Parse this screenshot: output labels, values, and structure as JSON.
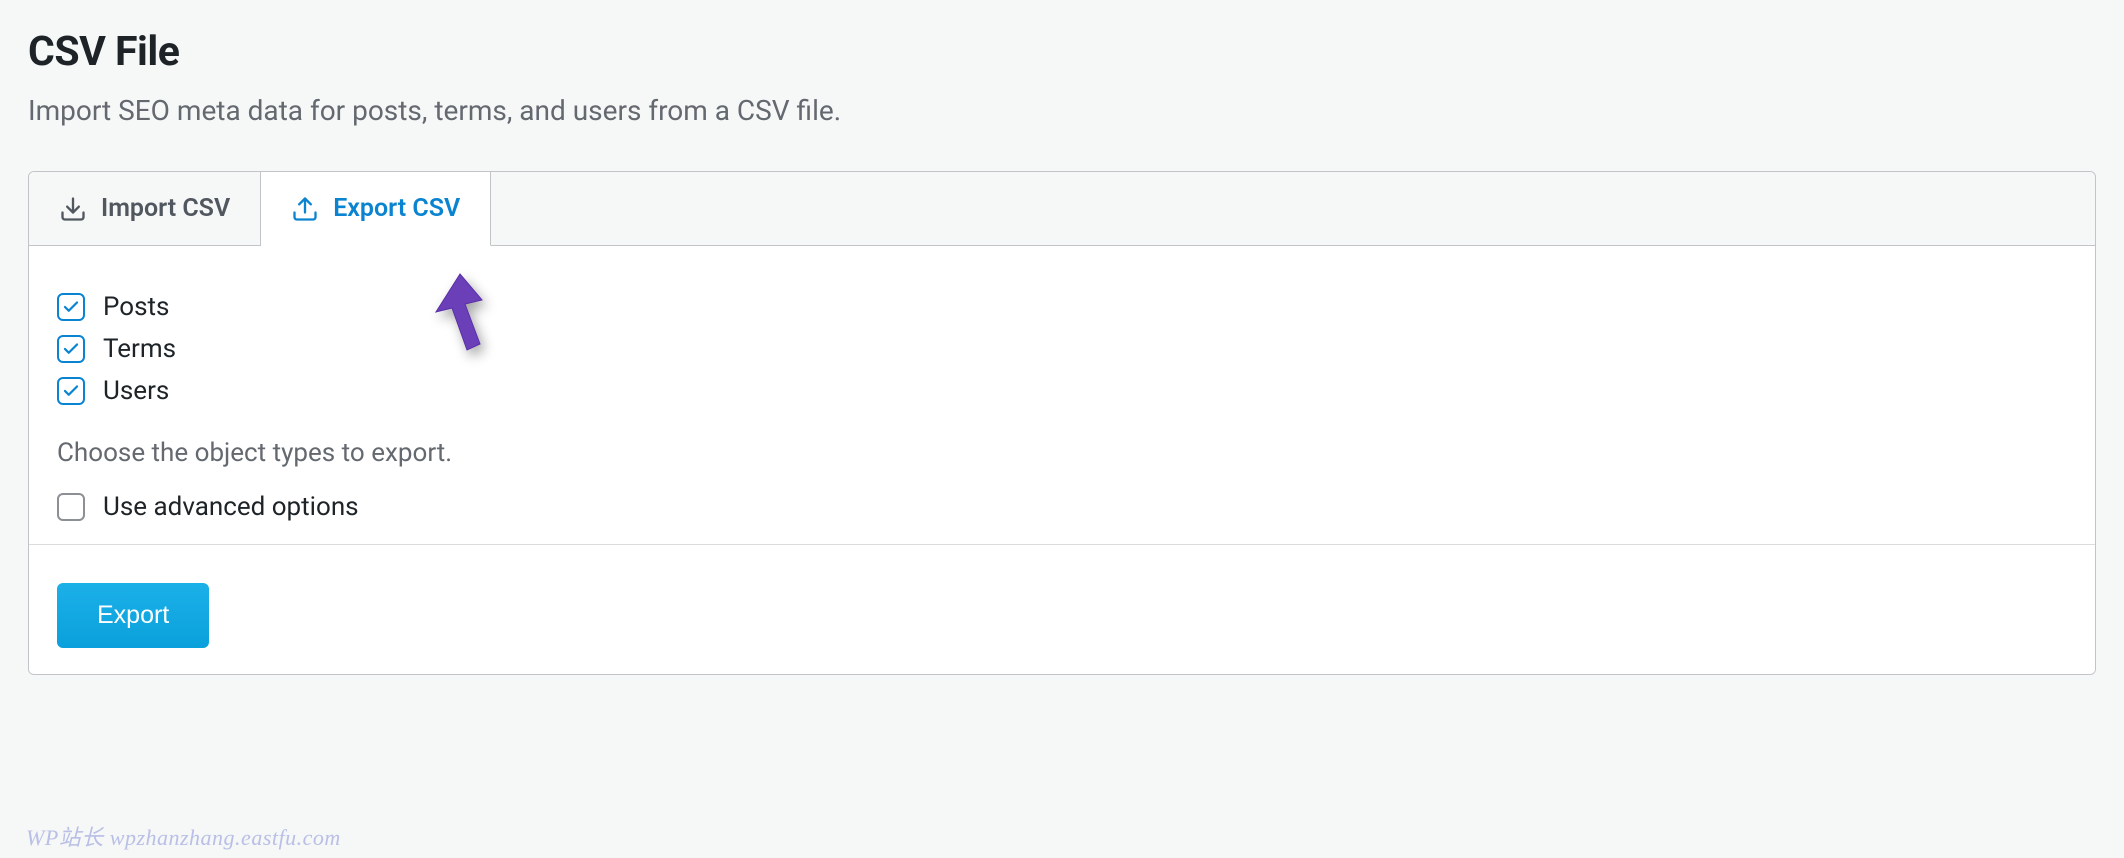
{
  "header": {
    "title": "CSV File",
    "subtitle": "Import SEO meta data for posts, terms, and users from a CSV file."
  },
  "tabs": {
    "import": {
      "label": "Import CSV",
      "icon": "download-icon"
    },
    "export": {
      "label": "Export CSV",
      "icon": "upload-icon"
    }
  },
  "export_form": {
    "options": [
      {
        "label": "Posts",
        "checked": true
      },
      {
        "label": "Terms",
        "checked": true
      },
      {
        "label": "Users",
        "checked": true
      }
    ],
    "helper_text": "Choose the object types to export.",
    "advanced": {
      "label": "Use advanced options",
      "checked": false
    },
    "submit_label": "Export"
  },
  "watermark": "WP站长 wpzhanzhang.eastfu.com"
}
